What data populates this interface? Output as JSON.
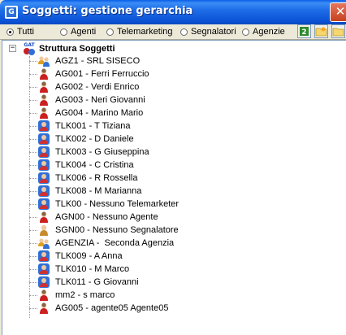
{
  "window": {
    "title": "Soggetti: gestione gerarchia",
    "close_symbol": "✕"
  },
  "filters": [
    {
      "label": "Tutti",
      "checked": true
    },
    {
      "label": "Agenti",
      "checked": false
    },
    {
      "label": "Telemarketing",
      "checked": false
    },
    {
      "label": "Segnalatori",
      "checked": false
    },
    {
      "label": "Agenzie",
      "checked": false
    }
  ],
  "tree": {
    "root": {
      "label": "Struttura Soggetti",
      "badge": "GAT",
      "expander": "−"
    },
    "items": [
      {
        "label": "AGZ1 - SRL SISECO",
        "kind": "agency"
      },
      {
        "label": "AG001 - Ferri Ferruccio",
        "kind": "agent"
      },
      {
        "label": "AG002 - Verdi Enrico",
        "kind": "agent"
      },
      {
        "label": "AG003 - Neri Giovanni",
        "kind": "agent"
      },
      {
        "label": "AG004 - Marino Mario",
        "kind": "agent"
      },
      {
        "label": "TLK001 - T Tiziana",
        "kind": "telemarketer"
      },
      {
        "label": "TLK002 - D Daniele",
        "kind": "telemarketer"
      },
      {
        "label": "TLK003 - G Giuseppina",
        "kind": "telemarketer"
      },
      {
        "label": "TLK004 - C Cristina",
        "kind": "telemarketer"
      },
      {
        "label": "TLK006 - R Rossella",
        "kind": "telemarketer"
      },
      {
        "label": "TLK008 - M Marianna",
        "kind": "telemarketer"
      },
      {
        "label": "TLK00 - Nessuno Telemarketer",
        "kind": "telemarketer"
      },
      {
        "label": "AGN00 - Nessuno Agente",
        "kind": "agent"
      },
      {
        "label": "SGN00 - Nessuno Segnalatore",
        "kind": "reporter"
      },
      {
        "label": "AGENZIA -  Seconda Agenzia",
        "kind": "agency"
      },
      {
        "label": "TLK009 - A Anna",
        "kind": "telemarketer"
      },
      {
        "label": "TLK010 - M Marco",
        "kind": "telemarketer"
      },
      {
        "label": "TLK011 - G Giovanni",
        "kind": "telemarketer"
      },
      {
        "label": "mm2 - s marco",
        "kind": "agent"
      },
      {
        "label": "AG005 - agente05 Agente05",
        "kind": "agent"
      }
    ]
  },
  "toolbar_icons": [
    "refresh-icon",
    "add-folder-icon",
    "open-folder-icon"
  ],
  "colors": {
    "title_bar": "#0b53d6",
    "agent": "#cc1f1f",
    "telemarketer": "#2f6fd6",
    "agency_a": "#e0a020",
    "agency_b": "#2f6fd6",
    "reporter": "#c88a2c"
  }
}
